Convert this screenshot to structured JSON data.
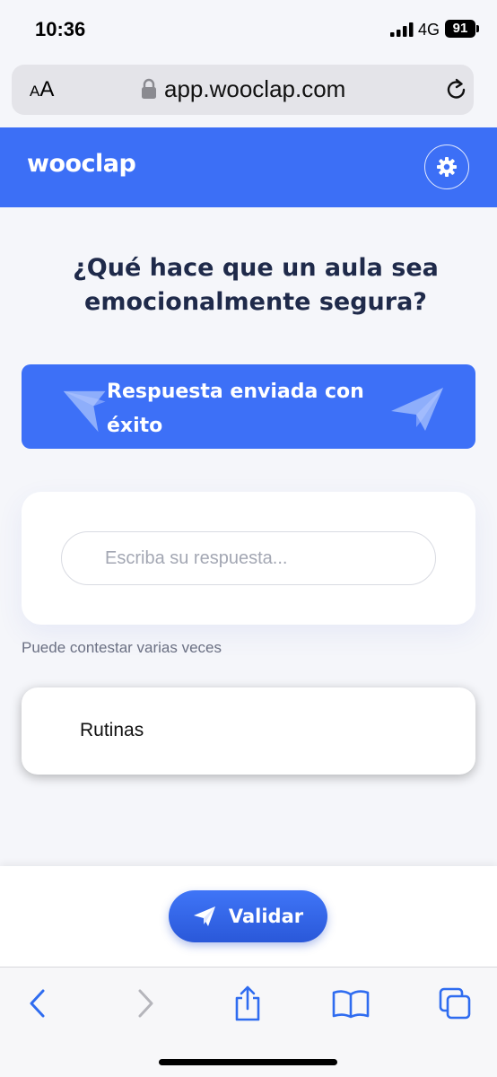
{
  "status_bar": {
    "time": "10:36",
    "network": "4G",
    "battery": "91"
  },
  "browser": {
    "text_size_label_small": "A",
    "text_size_label_large": "A",
    "url": "app.wooclap.com"
  },
  "app": {
    "logo": "wooclap",
    "brand_color": "#3c6ff6"
  },
  "question": {
    "text": "¿Qué hace que un aula sea emocionalmente segura?"
  },
  "banner": {
    "text": "Respuesta enviada con éxito"
  },
  "answer": {
    "placeholder": "Escriba su respuesta...",
    "value": "",
    "hint": "Puede contestar varias veces"
  },
  "previous_answers": [
    {
      "text": "Rutinas"
    }
  ],
  "actions": {
    "validate_label": "Validar"
  },
  "toolbar": {
    "icons": [
      "back-icon",
      "forward-icon",
      "share-icon",
      "bookmarks-icon",
      "tabs-icon"
    ]
  }
}
